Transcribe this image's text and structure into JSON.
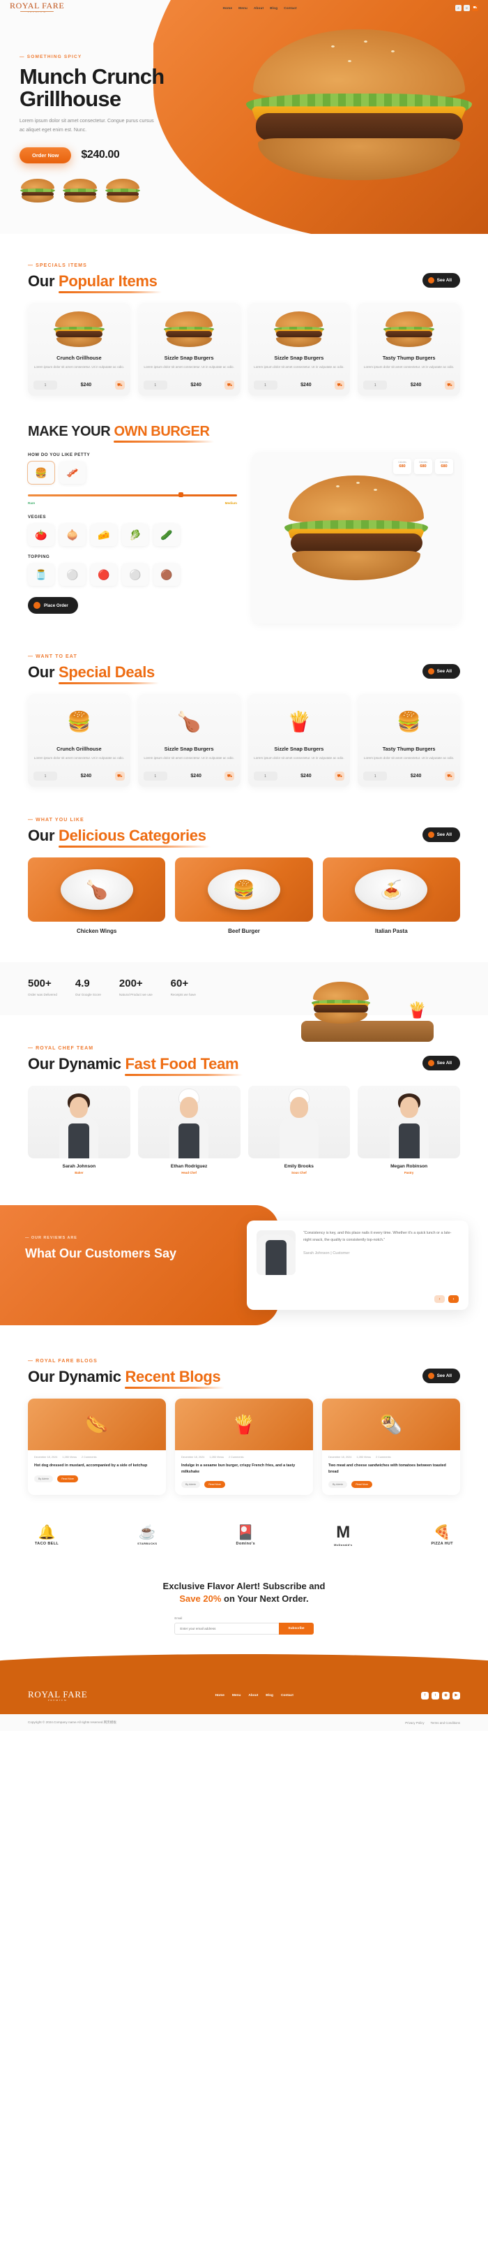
{
  "brand": {
    "name": "ROYAL FARE",
    "tagline": "PREMIUM"
  },
  "header": {
    "nav": [
      {
        "label": "Home"
      },
      {
        "label": "Menu"
      },
      {
        "label": "About"
      },
      {
        "label": "Blog"
      },
      {
        "label": "Contact"
      }
    ],
    "icons": [
      {
        "name": "search-icon",
        "glyph": "⌕"
      },
      {
        "name": "user-icon",
        "glyph": "☺"
      },
      {
        "name": "cart-icon",
        "glyph": "⛟"
      }
    ]
  },
  "hero": {
    "eyebrow": "— SOMETHING SPICY",
    "title": "Munch Crunch Grillhouse",
    "paragraph": "Lorem ipsum dolor sit amet consectetur. Congue purus cursus ac aliquet eget enim est. Nunc.",
    "cta": "Order Now",
    "price": "$240.00"
  },
  "popular": {
    "eyebrow": "— SPECIALS ITEMS",
    "title_lead": "Our",
    "title_highlight": "Popular Items",
    "see_all": "See All",
    "items": [
      {
        "name": "Crunch Grillhouse",
        "desc": "Lorem ipsum dolor sit amet consectetur. Ut in vulputate ac odio.",
        "qty": "1",
        "price": "$240",
        "cart": "⛟"
      },
      {
        "name": "Sizzle Snap Burgers",
        "desc": "Lorem ipsum dolor sit amet consectetur. Ut in vulputate ac odio.",
        "qty": "1",
        "price": "$240",
        "cart": "⛟"
      },
      {
        "name": "Sizzle Snap Burgers",
        "desc": "Lorem ipsum dolor sit amet consectetur. Ut in vulputate ac odio.",
        "qty": "1",
        "price": "$240",
        "cart": "⛟"
      },
      {
        "name": "Tasty Thump Burgers",
        "desc": "Lorem ipsum dolor sit amet consectetur. Ut in vulputate ac odio.",
        "qty": "1",
        "price": "$240",
        "cart": "⛟"
      }
    ]
  },
  "builder": {
    "title_lead": "MAKE YOUR",
    "title_highlight": "OWN BURGER",
    "petty_label": "HOW DO YOU LIKE PETTY",
    "petty_options": [
      {
        "name": "beef-patty",
        "glyph": "🍔"
      },
      {
        "name": "bacon-strip",
        "glyph": "🥓"
      }
    ],
    "slider": {
      "left_label": "Rare",
      "right_label": "Medium",
      "value_percent": 72
    },
    "vegies_label": "VEGIES",
    "vegies": [
      {
        "name": "tomato",
        "glyph": "🍅"
      },
      {
        "name": "onion",
        "glyph": "🧅"
      },
      {
        "name": "cheese-slice",
        "glyph": "🧀"
      },
      {
        "name": "lettuce",
        "glyph": "🥬"
      },
      {
        "name": "pickle",
        "glyph": "🥒"
      }
    ],
    "topping_label": "TOPPING",
    "toppings": [
      {
        "name": "mustard-sauce",
        "glyph": "🫙"
      },
      {
        "name": "mayo-sauce",
        "glyph": "⚪"
      },
      {
        "name": "ketchup-sauce",
        "glyph": "🔴"
      },
      {
        "name": "garlic-sauce",
        "glyph": "⚪"
      },
      {
        "name": "bbq-sauce",
        "glyph": "🟤"
      }
    ],
    "place_order": "Place Order",
    "nutrition": [
      {
        "label": "Calories",
        "value": "680"
      },
      {
        "label": "Calories",
        "value": "680"
      },
      {
        "label": "Calories",
        "value": "680"
      }
    ]
  },
  "deals": {
    "eyebrow": "— WANT TO EAT",
    "title_lead": "Our",
    "title_highlight": "Special Deals",
    "see_all": "See All",
    "items": [
      {
        "name": "Crunch Grillhouse",
        "desc": "Lorem ipsum dolor sit amet consectetur. Ut in vulputate ac odio.",
        "qty": "1",
        "price": "$240",
        "glyph": "🍔",
        "cart": "⛟"
      },
      {
        "name": "Sizzle Snap Burgers",
        "desc": "Lorem ipsum dolor sit amet consectetur. Ut in vulputate ac odio.",
        "qty": "1",
        "price": "$240",
        "glyph": "🍗",
        "cart": "⛟"
      },
      {
        "name": "Sizzle Snap Burgers",
        "desc": "Lorem ipsum dolor sit amet consectetur. Ut in vulputate ac odio.",
        "qty": "1",
        "price": "$240",
        "glyph": "🍟",
        "cart": "⛟"
      },
      {
        "name": "Tasty Thump Burgers",
        "desc": "Lorem ipsum dolor sit amet consectetur. Ut in vulputate ac odio.",
        "qty": "1",
        "price": "$240",
        "glyph": "🍔",
        "cart": "⛟"
      }
    ]
  },
  "categories": {
    "eyebrow": "— WHAT YOU LIKE",
    "title_lead": "Our",
    "title_highlight": "Delicious Categories",
    "see_all": "See All",
    "items": [
      {
        "name": "Chicken Wings",
        "glyph": "🍗"
      },
      {
        "name": "Beef Burger",
        "glyph": "🍔"
      },
      {
        "name": "Italian Pasta",
        "glyph": "🍝"
      }
    ]
  },
  "stats": [
    {
      "number": "500+",
      "label": "Order was Delivered"
    },
    {
      "number": "4.9",
      "label": "Our Google Score"
    },
    {
      "number": "200+",
      "label": "Natural Product we use"
    },
    {
      "number": "60+",
      "label": "Receipts we have"
    }
  ],
  "team": {
    "eyebrow": "— ROYAL CHEF TEAM",
    "title_lead": "Our Dynamic",
    "title_highlight": "Fast Food Team",
    "see_all": "See All",
    "members": [
      {
        "name": "Sarah Johnson",
        "role": "Baker"
      },
      {
        "name": "Ethan Rodriguez",
        "role": "Head Chef"
      },
      {
        "name": "Emily Brooks",
        "role": "Sous Chef"
      },
      {
        "name": "Megan Robinson",
        "role": "Pastry"
      }
    ]
  },
  "testimonial": {
    "eyebrow": "— OUR REVIEWS ARE",
    "title": "What Our Customers Say",
    "quote": "“Consistency is key, and this place nails it every time. Whether it's a quick lunch or a late-night snack, the quality is consistently top-notch.”",
    "author": "Sarah Johnson",
    "author_role": " | Customer",
    "prev": "‹",
    "next": "›"
  },
  "blogs": {
    "eyebrow": "— ROYAL FARE BLOGS",
    "title_lead": "Our Dynamic",
    "title_highlight": "Recent Blogs",
    "see_all": "See All",
    "posts": [
      {
        "date": "December 18, 2024",
        "comments": "1,280 Views",
        "comment_count": "2 Comments",
        "title": "Hot dog dressed in mustard, accompanied by a side of ketchup",
        "author": "By Admin",
        "tag": "Read More",
        "glyph": "🌭"
      },
      {
        "date": "December 18, 2024",
        "comments": "1,280 Views",
        "comment_count": "2 Comments",
        "title": "Indulge in a sesame bun burger, crispy French fries, and a tasty milkshake",
        "author": "By Admin",
        "tag": "Read More",
        "glyph": "🍟"
      },
      {
        "date": "December 18, 2024",
        "comments": "1,280 Views",
        "comment_count": "2 Comments",
        "title": "Two meat and cheese sandwiches with tomatoes between toasted bread",
        "author": "By Admin",
        "tag": "Read More",
        "glyph": "🌯"
      }
    ]
  },
  "brands": [
    {
      "name": "TACO BELL",
      "glyph": "🔔"
    },
    {
      "name": "STARBUCKS",
      "glyph": "☕"
    },
    {
      "name": "Domino's",
      "glyph": "🎴"
    },
    {
      "name": "McDonald's",
      "glyph": "M"
    },
    {
      "name": "PIZZA HUT",
      "glyph": "🍕"
    }
  ],
  "newsletter": {
    "headline_1": "Exclusive Flavor Alert! Subscribe and",
    "headline_2_lead": "Save 20%",
    "headline_2_rest": " on Your Next Order.",
    "field_label": "Email",
    "placeholder": "Enter your email address",
    "button": "Subscribe"
  },
  "footer": {
    "nav": [
      {
        "label": "Home"
      },
      {
        "label": "Menu"
      },
      {
        "label": "About"
      },
      {
        "label": "Blog"
      },
      {
        "label": "Contact"
      }
    ],
    "social": [
      {
        "name": "facebook-icon",
        "glyph": "f"
      },
      {
        "name": "twitter-icon",
        "glyph": "t"
      },
      {
        "name": "instagram-icon",
        "glyph": "◉"
      },
      {
        "name": "youtube-icon",
        "glyph": "▶"
      }
    ],
    "copyright": "Copyright © 2024.Company name All rights reserved.网页模板",
    "links": [
      {
        "label": "Privacy Policy"
      },
      {
        "label": "Terms and Conditions"
      }
    ]
  }
}
